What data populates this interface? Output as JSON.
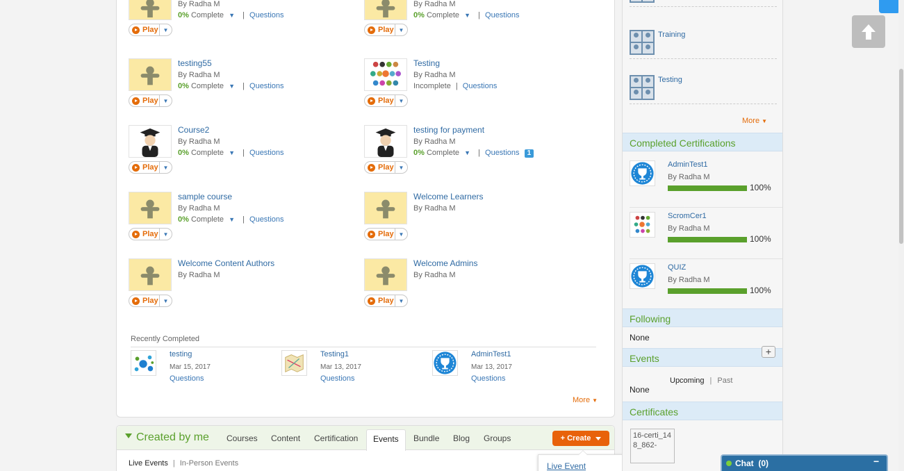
{
  "courses": [
    {
      "title": "",
      "by": "By Radha M",
      "pct": "0%",
      "complete": "Complete",
      "questions": "Questions",
      "thumb": "generic"
    },
    {
      "title": "",
      "by": "By Radha M",
      "pct": "0%",
      "complete": "Complete",
      "questions": "Questions",
      "thumb": "generic"
    },
    {
      "title": "testing55",
      "by": "By Radha M",
      "pct": "0%",
      "complete": "Complete",
      "questions": "Questions",
      "thumb": "generic"
    },
    {
      "title": "Testing",
      "by": "By Radha M",
      "pct": "",
      "complete": "Incomplete",
      "questions": "Questions",
      "thumb": "dots"
    },
    {
      "title": "Course2",
      "by": "By Radha M",
      "pct": "0%",
      "complete": "Complete",
      "questions": "Questions",
      "thumb": "graduate"
    },
    {
      "title": "testing for payment",
      "by": "By Radha M",
      "pct": "0%",
      "complete": "Complete",
      "questions": "Questions",
      "badge": "1",
      "thumb": "graduate"
    },
    {
      "title": "sample course",
      "by": "By Radha M",
      "pct": "0%",
      "complete": "Complete",
      "questions": "Questions",
      "thumb": "generic"
    },
    {
      "title": "Welcome Learners",
      "by": "By Radha M",
      "thumb": "generic"
    },
    {
      "title": "Welcome Content Authors",
      "by": "By Radha M",
      "thumb": "generic"
    },
    {
      "title": "Welcome Admins",
      "by": "By Radha M",
      "thumb": "generic"
    }
  ],
  "play_label": "Play",
  "recently_completed": {
    "heading": "Recently Completed",
    "items": [
      {
        "title": "testing",
        "date": "Mar 15, 2017",
        "questions": "Questions",
        "icon": "network-icon"
      },
      {
        "title": "Testing1",
        "date": "Mar 13, 2017",
        "questions": "Questions",
        "icon": "map-icon"
      },
      {
        "title": "AdminTest1",
        "date": "Mar 13, 2017",
        "questions": "Questions",
        "icon": "trophy-icon"
      }
    ],
    "more": "More"
  },
  "created_by_me": {
    "title": "Created by me",
    "tabs": [
      "Courses",
      "Content",
      "Certification",
      "Events",
      "Bundle",
      "Blog",
      "Groups"
    ],
    "active_tab": "Events",
    "create_button": "+ Create",
    "sub_tabs": [
      "Live Events",
      "In-Person Events"
    ],
    "menu_item": "Live Event"
  },
  "sidebar": {
    "groups": [
      "Training",
      "Testing"
    ],
    "more": "More",
    "completed_certifications": {
      "heading": "Completed Certifications",
      "items": [
        {
          "name": "AdminTest1",
          "by": "By Radha M",
          "pct": "100%",
          "progress": 1.0,
          "icon": "trophy-icon"
        },
        {
          "name": "ScromCer1",
          "by": "By Radha M",
          "pct": "100%",
          "progress": 1.0,
          "icon": "dots-icon"
        },
        {
          "name": "QUIZ",
          "by": "By Radha M",
          "pct": "100%",
          "progress": 1.0,
          "icon": "trophy-icon"
        }
      ]
    },
    "following": {
      "heading": "Following",
      "value": "None"
    },
    "events": {
      "heading": "Events",
      "tabs": [
        "Upcoming",
        "Past"
      ],
      "value": "None",
      "add": "+"
    },
    "certificates": {
      "heading": "Certificates",
      "img_alt": "16-certi_148_862-"
    }
  },
  "chat": {
    "label": "Chat",
    "count": "(0)",
    "minimize": "−"
  },
  "colors": {
    "accent_green": "#5aa02c",
    "link_blue": "#3a77b5",
    "orange": "#e46c0a",
    "section_blue": "#dcebf7"
  }
}
